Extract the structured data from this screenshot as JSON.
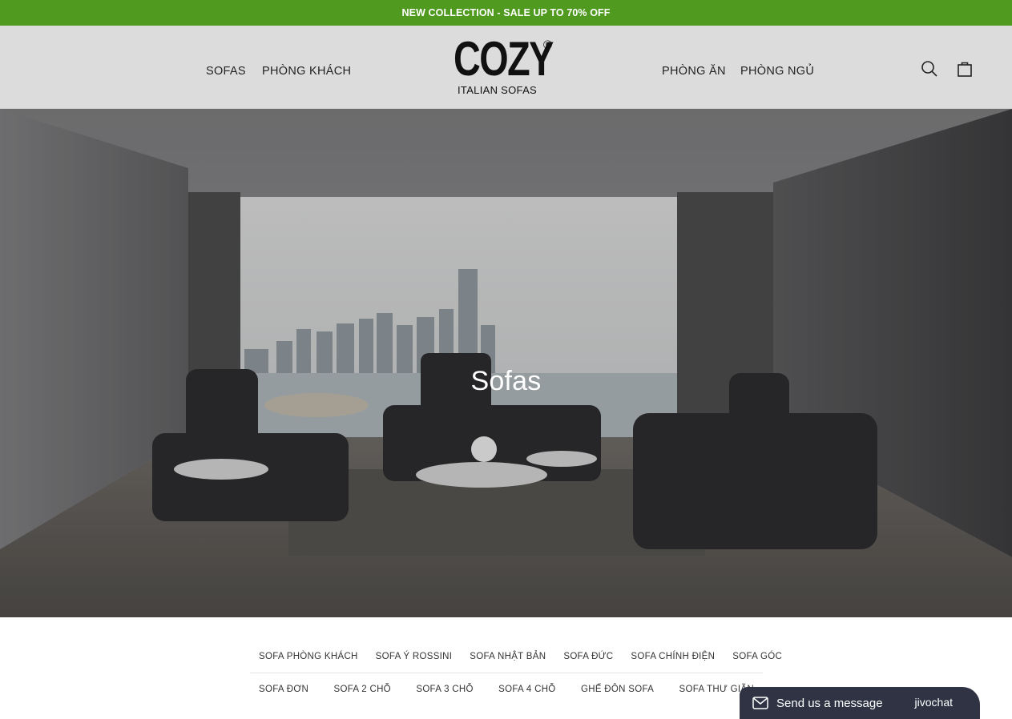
{
  "announcement": "NEW COLLECTION - SALE UP TO 70% OFF",
  "header": {
    "nav_left": [
      "SOFAS",
      "PHÒNG KHÁCH"
    ],
    "nav_right": [
      "PHÒNG ĂN",
      "PHÒNG NGỦ"
    ],
    "logo": {
      "mark": "COZY",
      "registered": "®",
      "subtitle": "ITALIAN SOFAS"
    },
    "icons": [
      "search-icon",
      "cart-icon"
    ]
  },
  "hero": {
    "title": "Sofas"
  },
  "categories": {
    "row1": [
      "SOFA PHÒNG KHÁCH",
      "SOFA Ý ROSSINI",
      "SOFA NHẬT BẢN",
      "SOFA ĐỨC",
      "SOFA CHÍNH ĐIỆN",
      "SOFA GÓC"
    ],
    "row2": [
      "SOFA ĐƠN",
      "SOFA 2 CHỖ",
      "SOFA 3 CHỖ",
      "SOFA 4 CHỖ",
      "GHẾ ĐÔN SOFA",
      "SOFA THƯ GIÃN"
    ]
  },
  "chat": {
    "label": "Send us a message",
    "brand": "jivochat"
  },
  "colors": {
    "announcement_bg": "#4f9a1f",
    "header_bg": "#dcdcdc",
    "chat_bg": "#2f3344"
  }
}
